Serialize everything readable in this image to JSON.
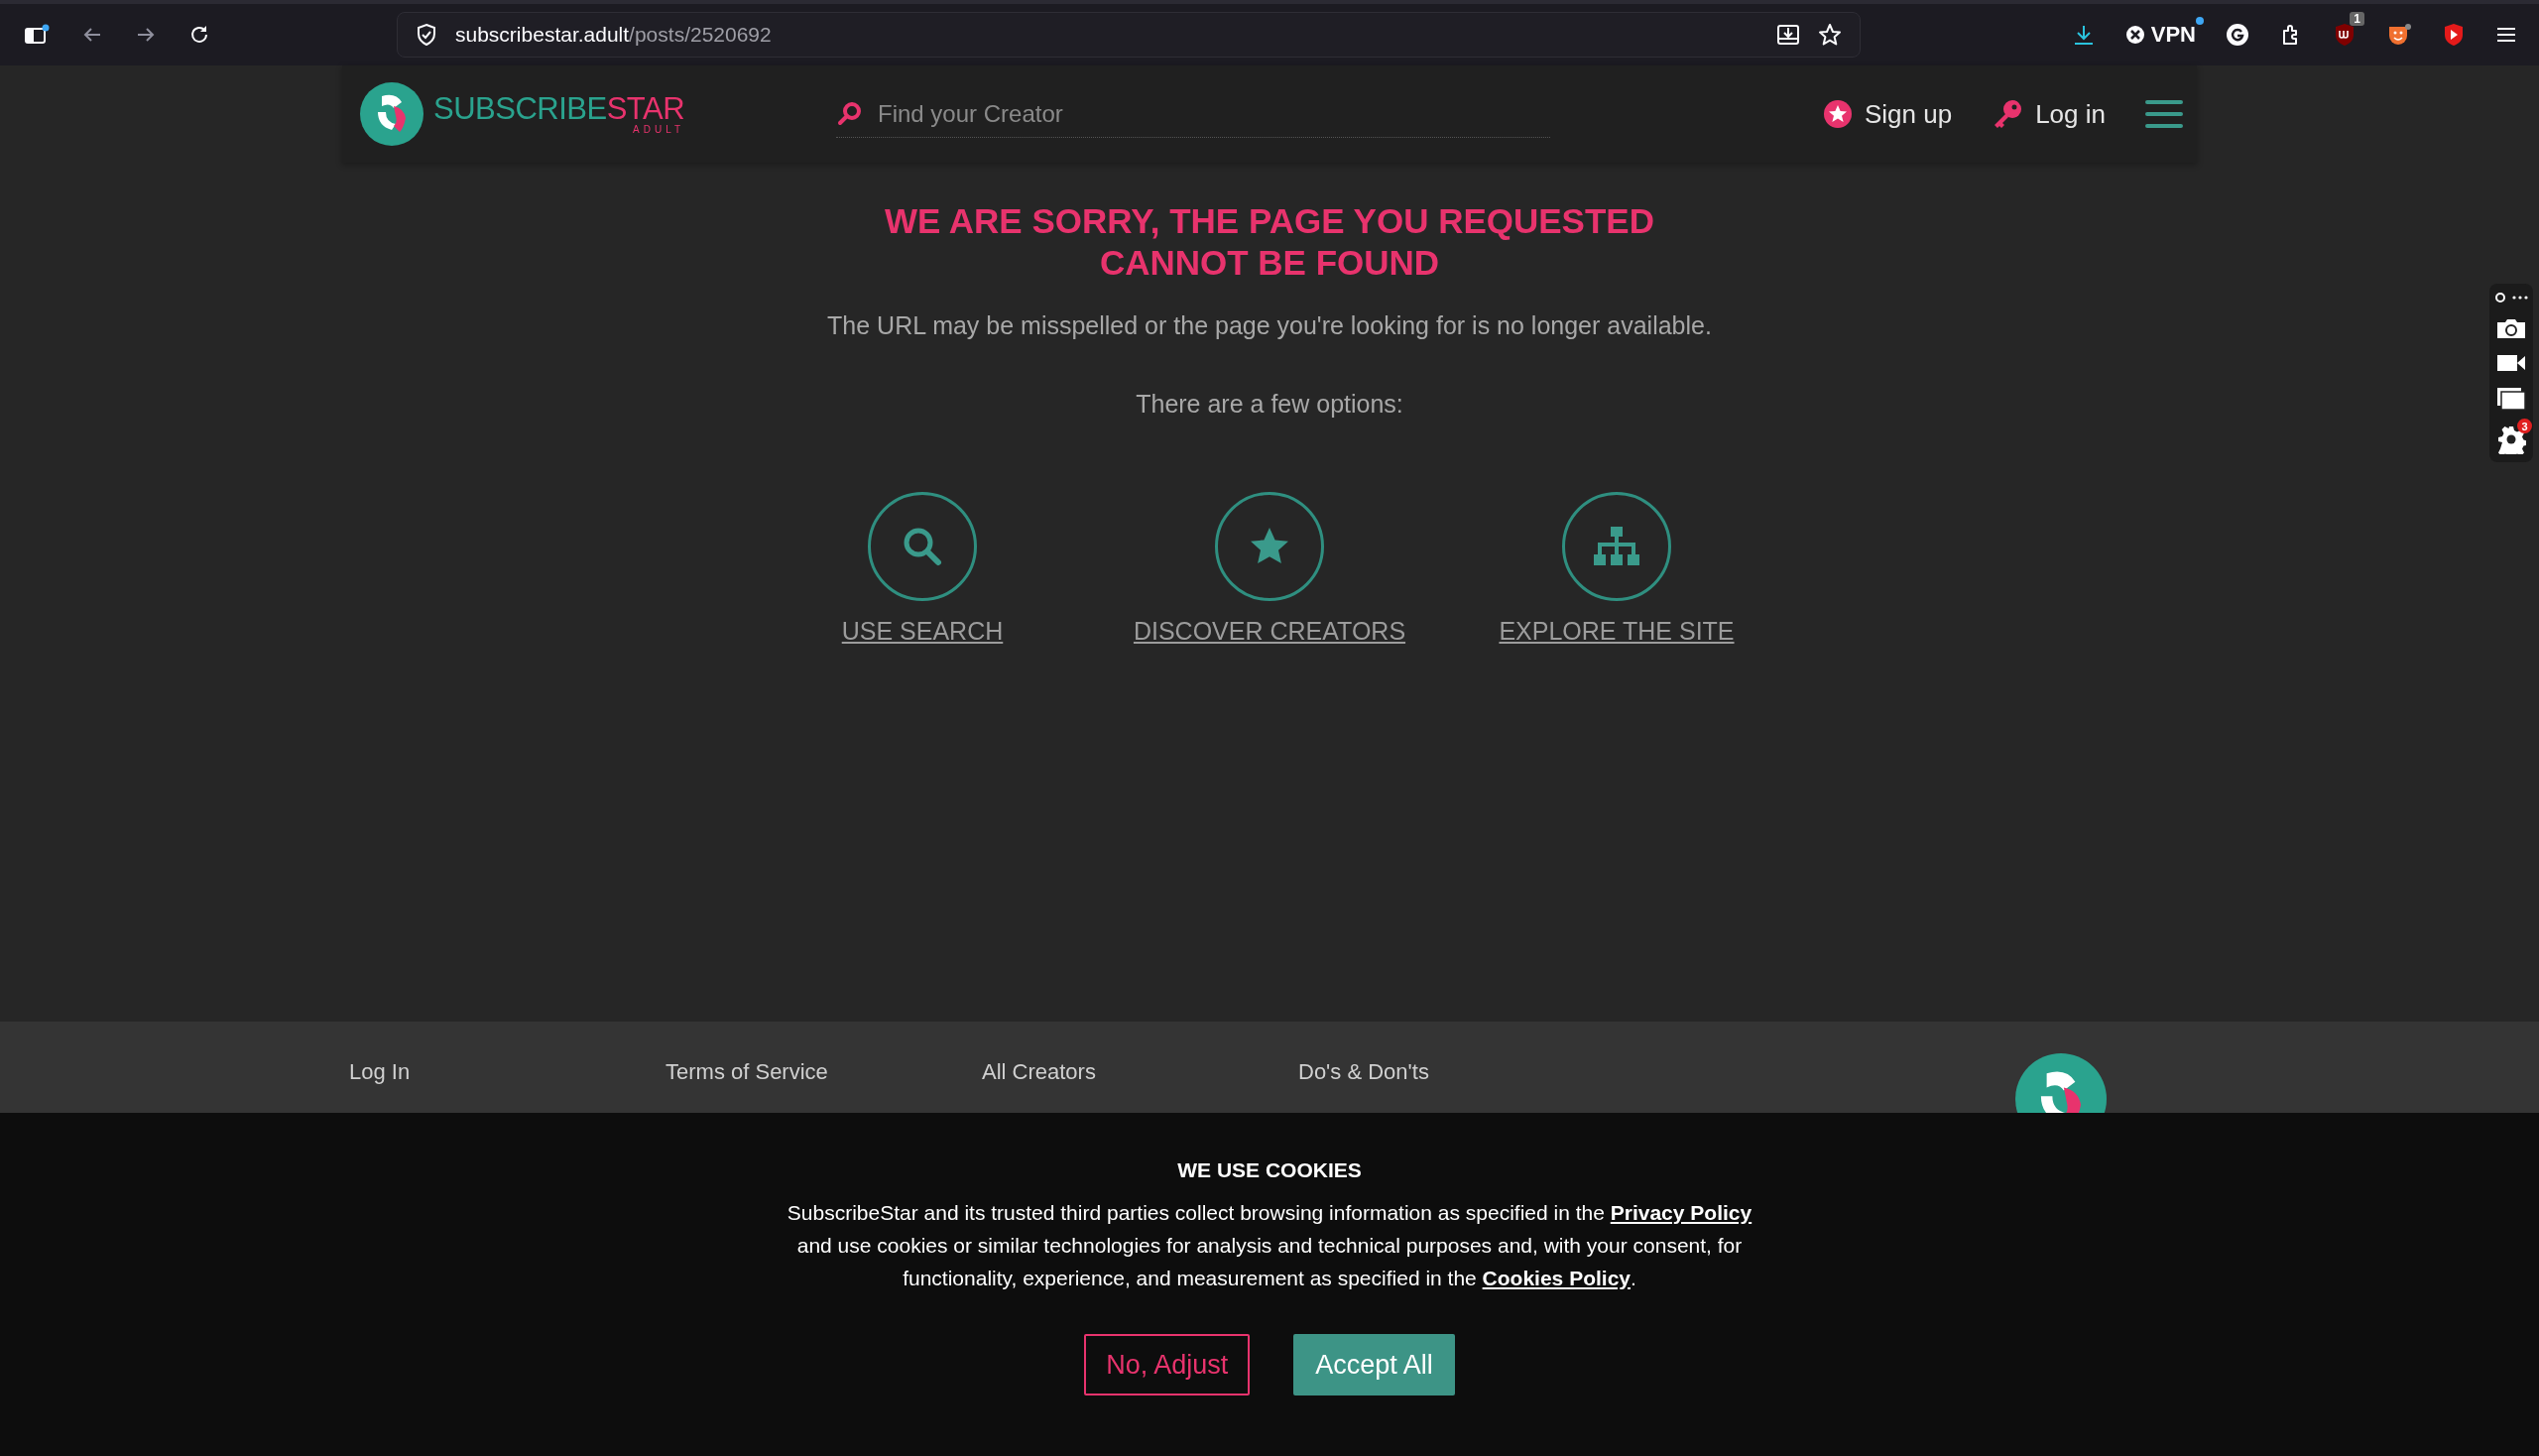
{
  "browser": {
    "url_host": "subscribestar.adult",
    "url_path": "/posts/2520692",
    "vpn_label": "VPN",
    "extension_badge": "1",
    "side_tool_badge": "3"
  },
  "header": {
    "logo_main": "SUBSCRIBE",
    "logo_accent": "STAR",
    "logo_sub": "ADULT",
    "search": {
      "placeholder": "Find your Creator"
    },
    "actions": [
      {
        "label": "Sign up",
        "kind": "signup"
      },
      {
        "label": "Log in",
        "kind": "login"
      }
    ]
  },
  "error": {
    "title_lines": [
      "WE ARE SORRY, THE PAGE YOU REQUESTED",
      "CANNOT BE FOUND"
    ],
    "message": "The URL may be misspelled or the page you're looking for is no longer available.",
    "options_intro": "There are a few options:",
    "options": [
      {
        "label": "USE SEARCH",
        "kind": "search"
      },
      {
        "label": "DISCOVER CREATORS",
        "kind": "star"
      },
      {
        "label": "EXPLORE THE SITE",
        "kind": "sitemap"
      }
    ]
  },
  "footer": {
    "columns": [
      [
        "Log In"
      ],
      [
        "Terms of Service"
      ],
      [
        "All Creators"
      ],
      [
        "Do's & Don'ts"
      ]
    ]
  },
  "cookie_banner": {
    "title": "WE USE COOKIES",
    "body": [
      {
        "kind": "text",
        "text": "SubscribeStar and its trusted third parties collect browsing information as specified in the "
      },
      {
        "kind": "link",
        "text": "Privacy Policy"
      },
      {
        "kind": "text",
        "text": " and use cookies or similar technologies for analysis and technical purposes and, with your consent, for functionality, experience, and measurement as specified in the "
      },
      {
        "kind": "link",
        "text": "Cookies Policy"
      },
      {
        "kind": "text",
        "text": "."
      }
    ],
    "buttons": [
      {
        "label": "No, Adjust",
        "kind": "secondary"
      },
      {
        "label": "Accept All",
        "kind": "primary"
      }
    ]
  }
}
